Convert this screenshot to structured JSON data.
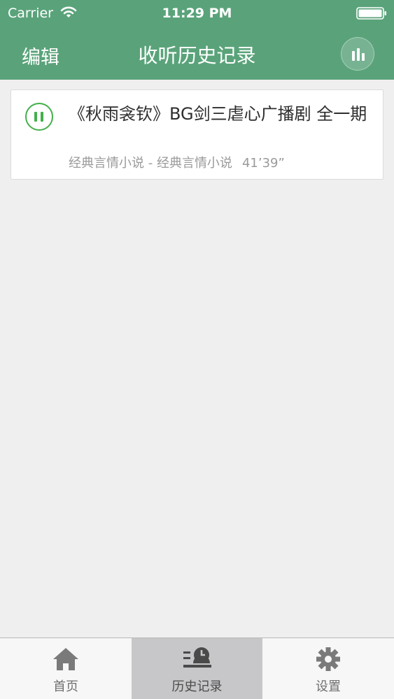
{
  "status_bar": {
    "carrier": "Carrier",
    "time": "11:29 PM"
  },
  "nav": {
    "edit_label": "编辑",
    "title": "收听历史记录",
    "now_playing_icon": "equalizer-icon"
  },
  "history": {
    "items": [
      {
        "title": "《秋雨衾钦》BG剑三虐心广播剧 全一期",
        "category": "经典言情小说 - 经典言情小说",
        "duration": "41’39”",
        "state_icon": "pause-icon"
      }
    ]
  },
  "tabbar": {
    "tabs": [
      {
        "label": "首页",
        "icon": "home-icon"
      },
      {
        "label": "历史记录",
        "icon": "history-icon",
        "active": true
      },
      {
        "label": "设置",
        "icon": "gear-icon"
      }
    ]
  },
  "colors": {
    "header_bg": "#5aa37a",
    "accent_green": "#43b04a",
    "page_bg": "#efeff0",
    "active_tab_bg": "#c7c7c9"
  }
}
